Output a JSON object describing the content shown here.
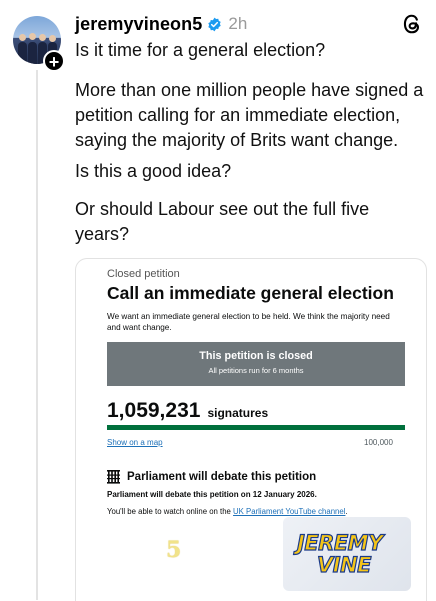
{
  "post": {
    "username": "jeremyvineon5",
    "time": "2h",
    "paragraphs": [
      "Is it time for a general election?",
      "More than one million people have signed a petition calling for an immediate election, saying the majority of Brits want change.",
      "Is this a good idea?",
      "Or should Labour see out the full five years?"
    ]
  },
  "petition": {
    "status_label": "Closed petition",
    "title": "Call an immediate general election",
    "description": "We want an immediate general election to be held. We think the majority need and want change.",
    "banner_title": "This petition is closed",
    "banner_subtitle": "All petitions run for 6 months",
    "signature_count": "1,059,231",
    "signature_word": "signatures",
    "progress_fraction": 1.0,
    "map_link": "Show on a map",
    "target": "100,000",
    "debate_title": "Parliament will debate this petition",
    "debate_date": "Parliament will debate this petition on 12 January 2026.",
    "watch_prefix": "You'll be able to watch online on the ",
    "watch_link": "UK Parliament YouTube channel",
    "watch_suffix": "."
  },
  "overlay": {
    "channel_mark": "5",
    "logo_line1": "JEREMY",
    "logo_line2": "VINE"
  },
  "colors": {
    "verified": "#1d9bf0",
    "progress": "#00703c",
    "banner": "#6f777b",
    "link": "#1d70b8",
    "logo_yellow": "#f5c518",
    "logo_blue": "#1a3a8a"
  },
  "icons": [
    "avatar",
    "plus-icon",
    "verified-badge-icon",
    "threads-logo-icon",
    "portcullis-icon"
  ]
}
